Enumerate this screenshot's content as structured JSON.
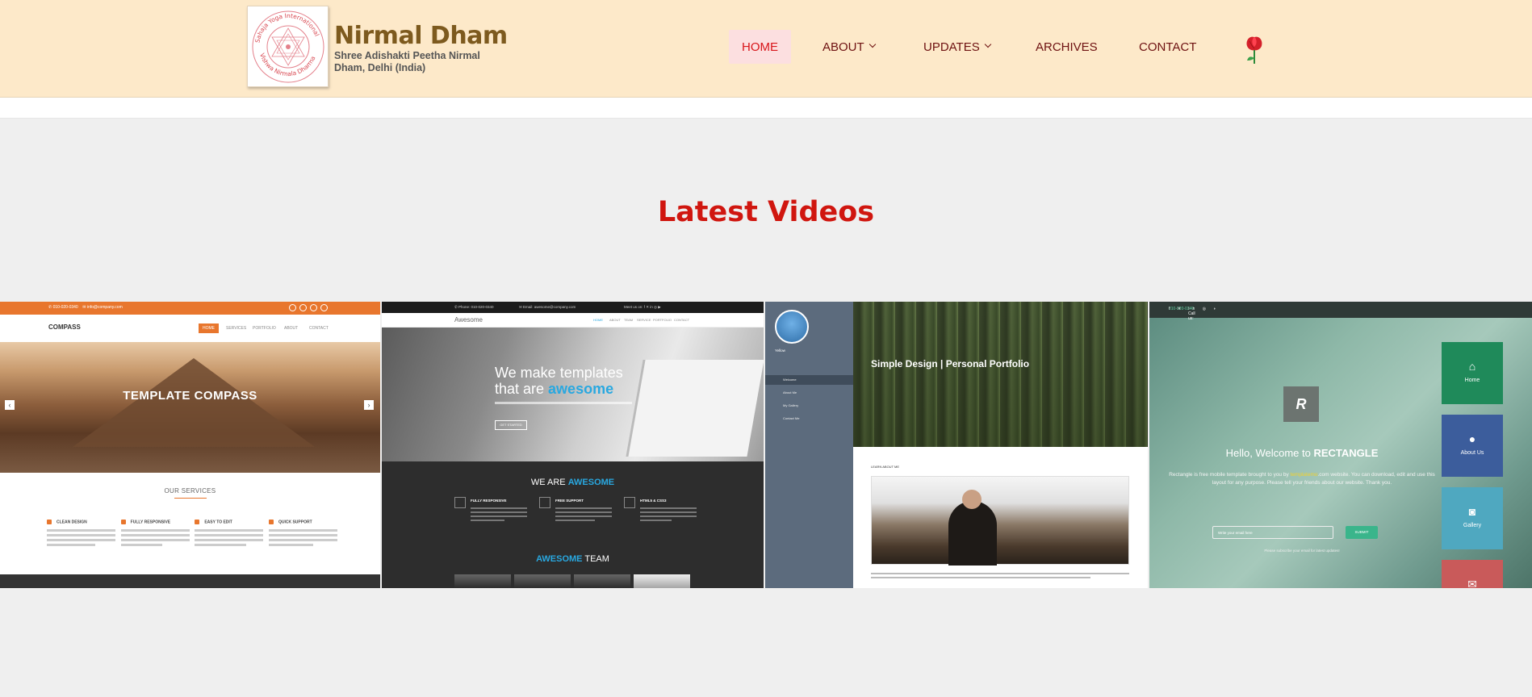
{
  "header": {
    "logo_alt": "Sahaja Yoga International - Vishwa Nirmala Dharma seal",
    "brand_title": "Nirmal Dham",
    "brand_subtitle": "Shree Adishakti Peetha Nirmal Dham, Delhi (India)",
    "nav": [
      {
        "label": "HOME",
        "active": true
      },
      {
        "label": "ABOUT",
        "dropdown": true
      },
      {
        "label": "UPDATES",
        "dropdown": true
      },
      {
        "label": "ARCHIVES"
      },
      {
        "label": "CONTACT"
      }
    ],
    "flower_icon": "rose-icon"
  },
  "section": {
    "title": "Latest Videos"
  },
  "videos": [
    {
      "name": "Compass template",
      "logo": "COMPASS",
      "menu": [
        "HOME",
        "SERVICES",
        "PORTFOLIO",
        "ABOUT",
        "CONTACT"
      ],
      "hero_title": "TEMPLATE COMPASS",
      "services_title": "OUR SERVICES",
      "services": [
        "CLEAN DESIGN",
        "FULLY RESPONSIVE",
        "EASY TO EDIT",
        "QUICK SUPPORT"
      ]
    },
    {
      "name": "Awesome template",
      "logo": "Awesome",
      "hero_line1": "We make templates",
      "hero_line2_a": "that are ",
      "hero_line2_b": "awesome",
      "button": "GET STARTED",
      "we_are_a": "WE ARE ",
      "we_are_b": "AWESOME",
      "features": [
        "FULLY RESPONSIVE",
        "FREE SUPPORT",
        "HTML5 & CSS3"
      ],
      "team_a": "AWESOME",
      "team_b": " TEAM"
    },
    {
      "name": "Simple Design template",
      "profile_name": "Yellow",
      "side_menu": [
        "Welcome",
        "About Me",
        "My Gallery",
        "Contact Me"
      ],
      "hero_title": "Simple Design | Personal Portfolio",
      "learn": "LEARN ABOUT ME"
    },
    {
      "name": "Rectangle template",
      "call_a": "Call us: ",
      "call_b": "010-020-0340",
      "logo": "R",
      "welcome_a": "Hello, Welcome to ",
      "welcome_b": "RECTANGLE",
      "desc_a": "Rectangle is free mobile template brought to you by ",
      "desc_b": "templatemo",
      "desc_c": ".com website. You can download, edit and use this layout for any purpose. Please tell your friends about our website. Thank you.",
      "email_placeholder": "Write your email here",
      "submit": "SUBMIT",
      "note": "Please subscribe your email for latest updates!",
      "tiles": [
        {
          "label": "Home",
          "color": "#1f8a5a",
          "icon": "home-icon"
        },
        {
          "label": "About Us",
          "color": "#3c5d9c",
          "icon": "user-icon"
        },
        {
          "label": "Gallery",
          "color": "#4fa8c0",
          "icon": "camera-icon"
        },
        {
          "label": "",
          "color": "#c95a5a",
          "icon": "mail-icon"
        }
      ]
    }
  ],
  "colors": {
    "header_bg": "#fde9c9",
    "brand": "#7d5a1e",
    "nav_text": "#6e1111",
    "nav_active": "#d8151a",
    "section_title": "#d0160f"
  }
}
